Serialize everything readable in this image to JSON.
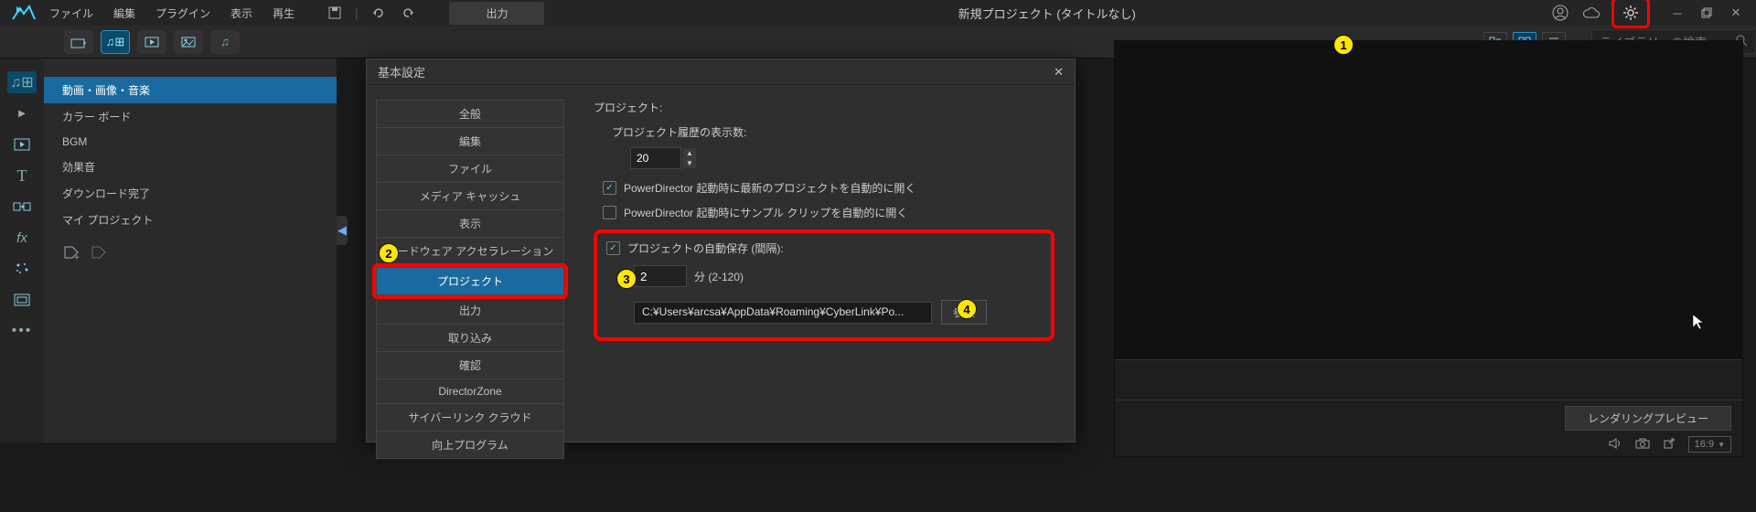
{
  "menubar": {
    "items": [
      "ファイル",
      "編集",
      "プラグイン",
      "表示",
      "再生"
    ],
    "output_label": "出力",
    "project_title": "新規プロジェクト (タイトルなし)"
  },
  "toolbar": {
    "search_placeholder": "ライブラリーの検索"
  },
  "library_sidebar": {
    "items": [
      "動画・画像・音楽",
      "カラー ボード",
      "BGM",
      "効果音",
      "ダウンロード完了",
      "マイ プロジェクト"
    ],
    "selected_index": 0
  },
  "dialog": {
    "title": "基本設定",
    "nav": [
      "全般",
      "編集",
      "ファイル",
      "メディア キャッシュ",
      "表示",
      "ハードウェア アクセラレーション",
      "プロジェクト",
      "出力",
      "取り込み",
      "確認",
      "DirectorZone",
      "サイバーリンク クラウド",
      "向上プログラム"
    ],
    "nav_selected_index": 6
  },
  "settings_project": {
    "heading": "プロジェクト:",
    "history_label": "プロジェクト履歴の表示数:",
    "history_value": "20",
    "open_recent_label": "PowerDirector 起動時に最新のプロジェクトを自動的に開く",
    "open_sample_label": "PowerDirector 起動時にサンプル クリップを自動的に開く",
    "autosave_label": "プロジェクトの自動保存 (間隔):",
    "interval_value": "2",
    "interval_unit": "分 (2-120)",
    "path_value": "C:¥Users¥arcsa¥AppData¥Roaming¥CyberLink¥Po...",
    "browse_label": "参照"
  },
  "preview": {
    "render_preview_label": "レンダリングプレビュー",
    "aspect_label": "16:9"
  },
  "callouts": {
    "c1": "1",
    "c2": "2",
    "c3": "3",
    "c4": "4"
  }
}
